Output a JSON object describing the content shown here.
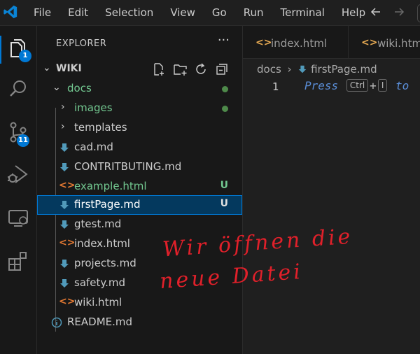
{
  "menu": [
    "File",
    "Edit",
    "Selection",
    "View",
    "Go",
    "Run",
    "Terminal",
    "Help"
  ],
  "activity": {
    "explorer_badge": "1",
    "scm_badge": "11"
  },
  "explorer": {
    "title": "EXPLORER",
    "more": "···",
    "root": "WIKI",
    "items": [
      {
        "label": "docs",
        "kind": "folder-open",
        "color": "#73c991",
        "marker": "dot"
      },
      {
        "label": "images",
        "kind": "folder",
        "color": "#73c991",
        "marker": "dot"
      },
      {
        "label": "templates",
        "kind": "folder",
        "color": "#cccccc",
        "marker": ""
      },
      {
        "label": "cad.md",
        "kind": "md",
        "color": "#cccccc",
        "marker": ""
      },
      {
        "label": "CONTRITBUTING.md",
        "kind": "md",
        "color": "#cccccc",
        "marker": ""
      },
      {
        "label": "example.html",
        "kind": "html",
        "color": "#73c991",
        "marker": "U"
      },
      {
        "label": "firstPage.md",
        "kind": "md",
        "color": "#ffffff",
        "marker": "U"
      },
      {
        "label": "gtest.md",
        "kind": "md",
        "color": "#cccccc",
        "marker": ""
      },
      {
        "label": "index.html",
        "kind": "html",
        "color": "#cccccc",
        "marker": ""
      },
      {
        "label": "projects.md",
        "kind": "md",
        "color": "#cccccc",
        "marker": ""
      },
      {
        "label": "safety.md",
        "kind": "md",
        "color": "#cccccc",
        "marker": ""
      },
      {
        "label": "wiki.html",
        "kind": "html",
        "color": "#cccccc",
        "marker": ""
      },
      {
        "label": "README.md",
        "kind": "info",
        "color": "#cccccc",
        "marker": ""
      }
    ]
  },
  "tabs": [
    {
      "label": "index.html"
    },
    {
      "label": "wiki.html"
    }
  ],
  "editor": {
    "breadcrumb_folder": "docs",
    "breadcrumb_sep": "›",
    "breadcrumb_file": "firstPage.md",
    "line_number": "1",
    "hint_word": "Press",
    "key1": "Ctrl",
    "plus": "+",
    "key2": "I",
    "hint_rest": "to"
  },
  "annotation": {
    "line1": "Wir öffnen die",
    "line2": "neue Datei"
  },
  "colors": {
    "accent": "#0078d4",
    "untracked": "#73c991",
    "annotation": "#e0202a"
  }
}
